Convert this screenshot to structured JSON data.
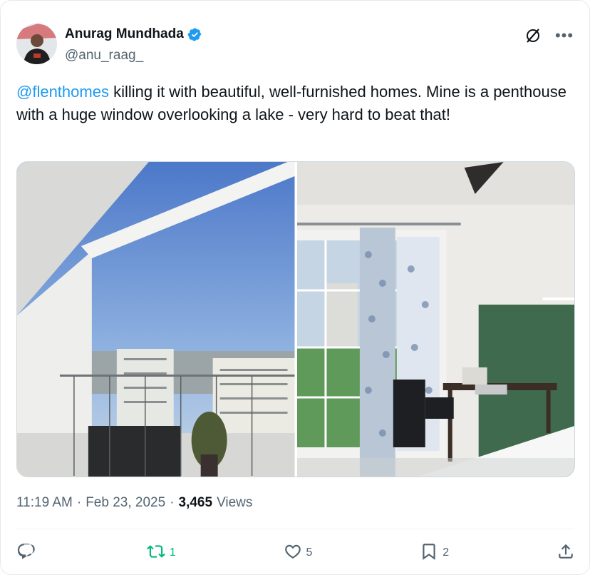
{
  "author": {
    "display_name": "Anurag Mundhada",
    "handle": "@anu_raag_",
    "verified": true
  },
  "icons": {
    "grok": "grok-icon",
    "more": "more-icon",
    "reply": "reply-icon",
    "retweet": "retweet-icon",
    "like": "heart-icon",
    "bookmark": "bookmark-icon",
    "share": "share-icon"
  },
  "tweet": {
    "mention": "@flenthomes",
    "text": " killing it with beautiful, well-furnished homes. Mine is a penthouse with a huge window overlooking a lake - very hard to beat that!"
  },
  "media": {
    "photos": [
      "balcony-view-photo",
      "bedroom-photo"
    ]
  },
  "meta": {
    "time": "11:19 AM",
    "sep1": "·",
    "date": "Feb 23, 2025",
    "sep2": "·",
    "views_count": "3,465",
    "views_label": "Views"
  },
  "actions": {
    "reply_count": "",
    "retweet_count": "1",
    "like_count": "5",
    "bookmark_count": "2"
  },
  "colors": {
    "accent": "#1d9bf0",
    "retweet": "#00ba7c",
    "text": "#0f1419",
    "secondary": "#536471"
  }
}
